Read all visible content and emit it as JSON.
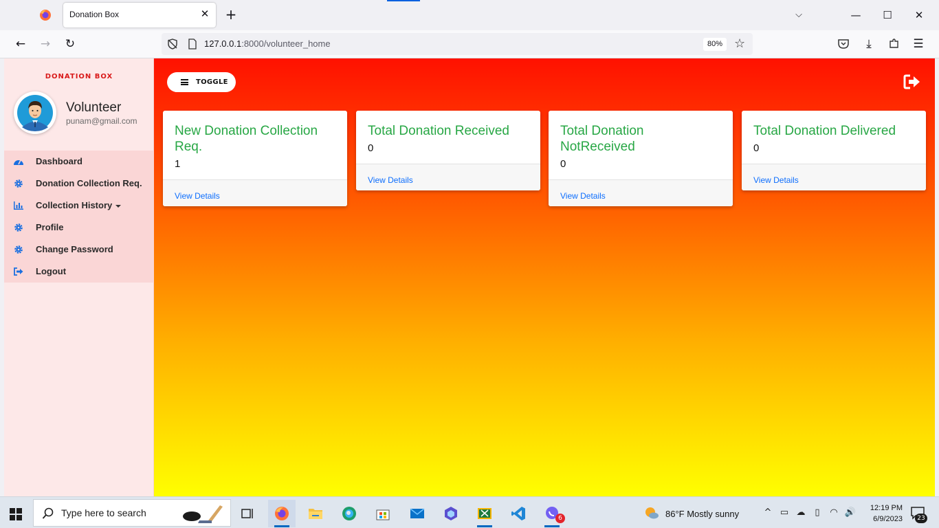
{
  "browser": {
    "tab_title": "Donation Box",
    "url_host": "127.0.0.1",
    "url_rest": ":8000/volunteer_home",
    "zoom": "80%"
  },
  "sidebar": {
    "brand": "DONATION BOX",
    "user_name": "Volunteer",
    "user_email": "punam@gmail.com",
    "items": [
      {
        "label": "Dashboard",
        "icon": "dashboard-icon"
      },
      {
        "label": "Donation Collection Req.",
        "icon": "gear-icon"
      },
      {
        "label": "Collection History",
        "icon": "bar-chart-icon",
        "has_dropdown": true
      },
      {
        "label": "Profile",
        "icon": "gear-icon"
      },
      {
        "label": "Change Password",
        "icon": "gear-icon"
      },
      {
        "label": "Logout",
        "icon": "sign-out-icon"
      }
    ]
  },
  "main": {
    "toggle_label": "TOGGLE",
    "cards": [
      {
        "title": "New Donation Collection Req.",
        "value": "1",
        "link": "View Details"
      },
      {
        "title": "Total Donation Received",
        "value": "0",
        "link": "View Details"
      },
      {
        "title": "Total Donation NotReceived",
        "value": "0",
        "link": "View Details"
      },
      {
        "title": "Total Donation Delivered",
        "value": "0",
        "link": "View Details"
      }
    ],
    "colors": {
      "gradient_top": "#ff1100",
      "gradient_bottom": "#ffff00",
      "card_title": "#28a745",
      "link": "#0d6efd",
      "brand": "#d91a1a"
    }
  },
  "taskbar": {
    "search_placeholder": "Type here to search",
    "weather": "86°F  Mostly sunny",
    "time": "12:19 PM",
    "date": "6/9/2023",
    "mail_badge": "6",
    "notification_count": "23"
  }
}
